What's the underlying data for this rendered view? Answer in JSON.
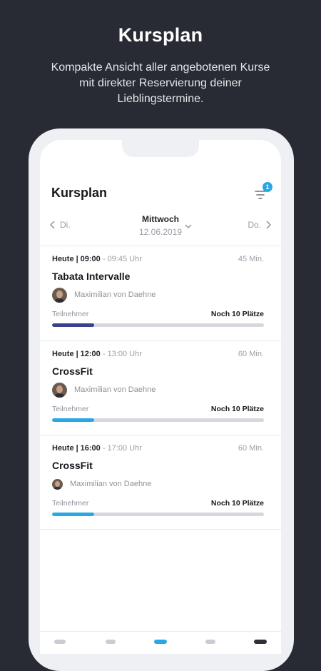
{
  "promo": {
    "title": "Kursplan",
    "subtitle": "Kompakte Ansicht aller angebotenen Kurse mit direkter Reservierung deiner Lieblingstermine."
  },
  "app": {
    "title": "Kursplan",
    "filter_badge": "1",
    "day_nav": {
      "prev": "Di.",
      "current_weekday": "Mittwoch",
      "current_date": "12.06.2019",
      "next": "Do."
    }
  },
  "courses": [
    {
      "day": "Heute",
      "start": "09:00",
      "end": "- 09:45 Uhr",
      "duration": "45 Min.",
      "title": "Tabata Intervalle",
      "trainer": "Maximilian von Daehne",
      "participants_label": "Teilnehmer",
      "spots": "Noch 10 Plätze",
      "fill": 0.2,
      "color": "#3b3f8f"
    },
    {
      "day": "Heute",
      "start": "12:00",
      "end": "- 13:00 Uhr",
      "duration": "60 Min.",
      "title": "CrossFit",
      "trainer": "Maximilian von Daehne",
      "participants_label": "Teilnehmer",
      "spots": "Noch 10 Plätze",
      "fill": 0.2,
      "color": "#2aa8e6"
    },
    {
      "day": "Heute",
      "start": "16:00",
      "end": "- 17:00 Uhr",
      "duration": "60 Min.",
      "title": "CrossFit",
      "trainer": "Maximilian von Daehne",
      "participants_label": "Teilnehmer",
      "spots": "Noch 10 Plätze",
      "fill": 0.2,
      "color": "#2aa8e6"
    }
  ],
  "colors": {
    "background": "#282b33",
    "accent": "#2aa8e6",
    "accent_dark": "#3b3f8f"
  }
}
